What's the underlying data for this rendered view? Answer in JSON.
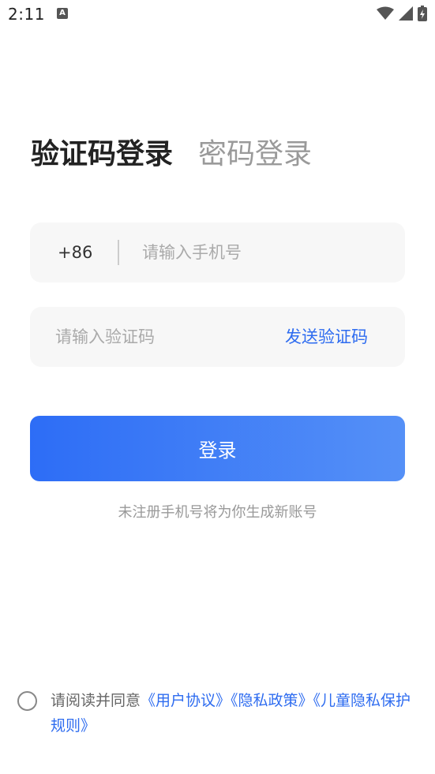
{
  "status_bar": {
    "time": "2:11",
    "icons": [
      "notification-a-icon",
      "wifi-icon",
      "signal-icon",
      "battery-charging-icon"
    ]
  },
  "tabs": {
    "active": "验证码登录",
    "inactive": "密码登录"
  },
  "phone": {
    "country_code": "+86",
    "placeholder": "请输入手机号",
    "value": ""
  },
  "code": {
    "placeholder": "请输入验证码",
    "value": "",
    "send_label": "发送验证码"
  },
  "login_button_label": "登录",
  "hint": "未注册手机号将为你生成新账号",
  "agreement": {
    "prefix": "请阅读并同意",
    "user_agreement": "《用户协议》",
    "privacy_policy": "《隐私政策》",
    "children_privacy": "《儿童隐私保护规则》"
  },
  "colors": {
    "accent": "#2e6cf0",
    "button_gradient_start": "#2d6df6",
    "button_gradient_end": "#5590f7",
    "input_bg": "#f7f7f7"
  }
}
